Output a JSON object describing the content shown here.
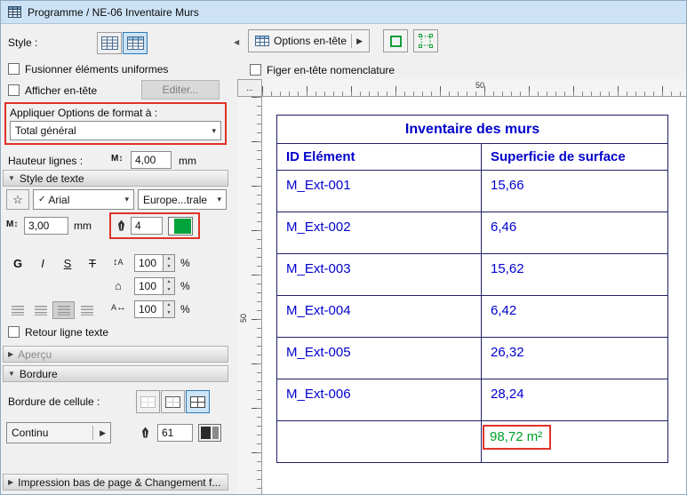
{
  "window": {
    "title": "Programme / NE-06 Inventaire Murs"
  },
  "icons": {
    "collapse_left": "◀",
    "chevron_down": "▾",
    "menu_arrow": "▶",
    "section_expanded": "▼",
    "section_collapsed": "▶",
    "font_check": "✓",
    "favorite_star": "☆",
    "updown_arrow": "↕",
    "leftright_arrow": "↔",
    "house": "⌂",
    "letter_m": "M",
    "letter_a": "A",
    "spin_up": "▲",
    "spin_down": "▼"
  },
  "left_panel": {
    "style_label": "Style :",
    "merge_uniform_label": "Fusionner éléments uniformes",
    "show_header_label": "Afficher en-tête",
    "edit_button": "Editer...",
    "apply_format_label": "Appliquer Options de format à :",
    "apply_format_value": "Total général",
    "row_height_label": "Hauteur lignes :",
    "row_height_value": "4,00",
    "row_height_unit": "mm",
    "text_style_section": "Style de texte",
    "font_family": "Arial",
    "font_encoding": "Europe...trale",
    "text_size_value": "3,00",
    "text_size_unit": "mm",
    "pen_value": "4",
    "format_buttons": [
      "G",
      "I",
      "S",
      "T"
    ],
    "spacing": {
      "values": [
        "100",
        "100",
        "100"
      ],
      "unit": "%"
    },
    "wrap_label": "Retour ligne texte",
    "preview_section": "Aperçu",
    "border_section": "Bordure",
    "cell_border_label": "Bordure de cellule :",
    "line_type_value": "Continu",
    "border_pen_value": "61",
    "footer_section": "Impression bas de page & Changement f..."
  },
  "toolbar": {
    "header_options_label": "Options en-tête",
    "freeze_header_label": "Figer en-tête nomenclature"
  },
  "rulers": {
    "corner": "...",
    "h_mark": "50",
    "v_mark": "50"
  },
  "table": {
    "title": "Inventaire des murs",
    "columns": [
      "ID Elément",
      "Superficie de surface"
    ],
    "rows": [
      {
        "id": "M_Ext-001",
        "area": "15,66"
      },
      {
        "id": "M_Ext-002",
        "area": "6,46"
      },
      {
        "id": "M_Ext-003",
        "area": "15,62"
      },
      {
        "id": "M_Ext-004",
        "area": "6,42"
      },
      {
        "id": "M_Ext-005",
        "area": "26,32"
      },
      {
        "id": "M_Ext-006",
        "area": "28,24"
      }
    ],
    "total": "98,72 m²"
  },
  "colors": {
    "table_text": "#0000cd",
    "table_border": "#202066",
    "total_green": "#00a028",
    "highlight_red": "#e03229",
    "selected_blue": "#cce4f7",
    "titlebar_blue": "#cde3f5"
  }
}
